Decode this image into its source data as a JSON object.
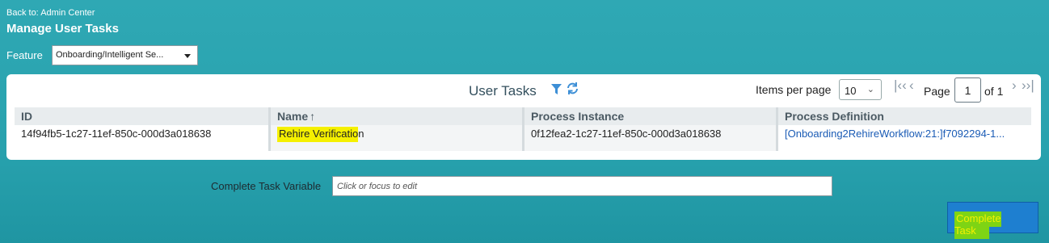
{
  "header": {
    "back_link": "Back to: Admin Center",
    "title": "Manage User Tasks"
  },
  "feature": {
    "label": "Feature",
    "selected": "Onboarding/Intelligent Se..."
  },
  "panel": {
    "title": "User Tasks",
    "filter_icon": "filter-icon",
    "refresh_icon": "refresh-icon",
    "items_per_page_label": "Items per page",
    "items_per_page_value": "10",
    "page_label": "Page",
    "page_value": "1",
    "page_of": "of 1"
  },
  "table": {
    "columns": [
      "ID",
      "Name",
      "Process Instance",
      "Process Definition"
    ],
    "rows": [
      {
        "id": "14f94fb5-1c27-11ef-850c-000d3a018638",
        "name_highlighted": "Rehire Verificatio",
        "name_rest": "n",
        "process_instance": "0f12fea2-1c27-11ef-850c-000d3a018638",
        "process_definition": "[Onboarding2RehireWorkflow:21:]f7092294-1..."
      }
    ]
  },
  "complete_task_variable": {
    "label": "Complete Task Variable",
    "placeholder": "Click or focus to edit"
  },
  "actions": {
    "complete_task": "Complete Task"
  },
  "colors": {
    "background": "#2fa8b4",
    "highlight": "#f5f000",
    "button": "#1e7fd0",
    "link": "#1a5bb5"
  }
}
